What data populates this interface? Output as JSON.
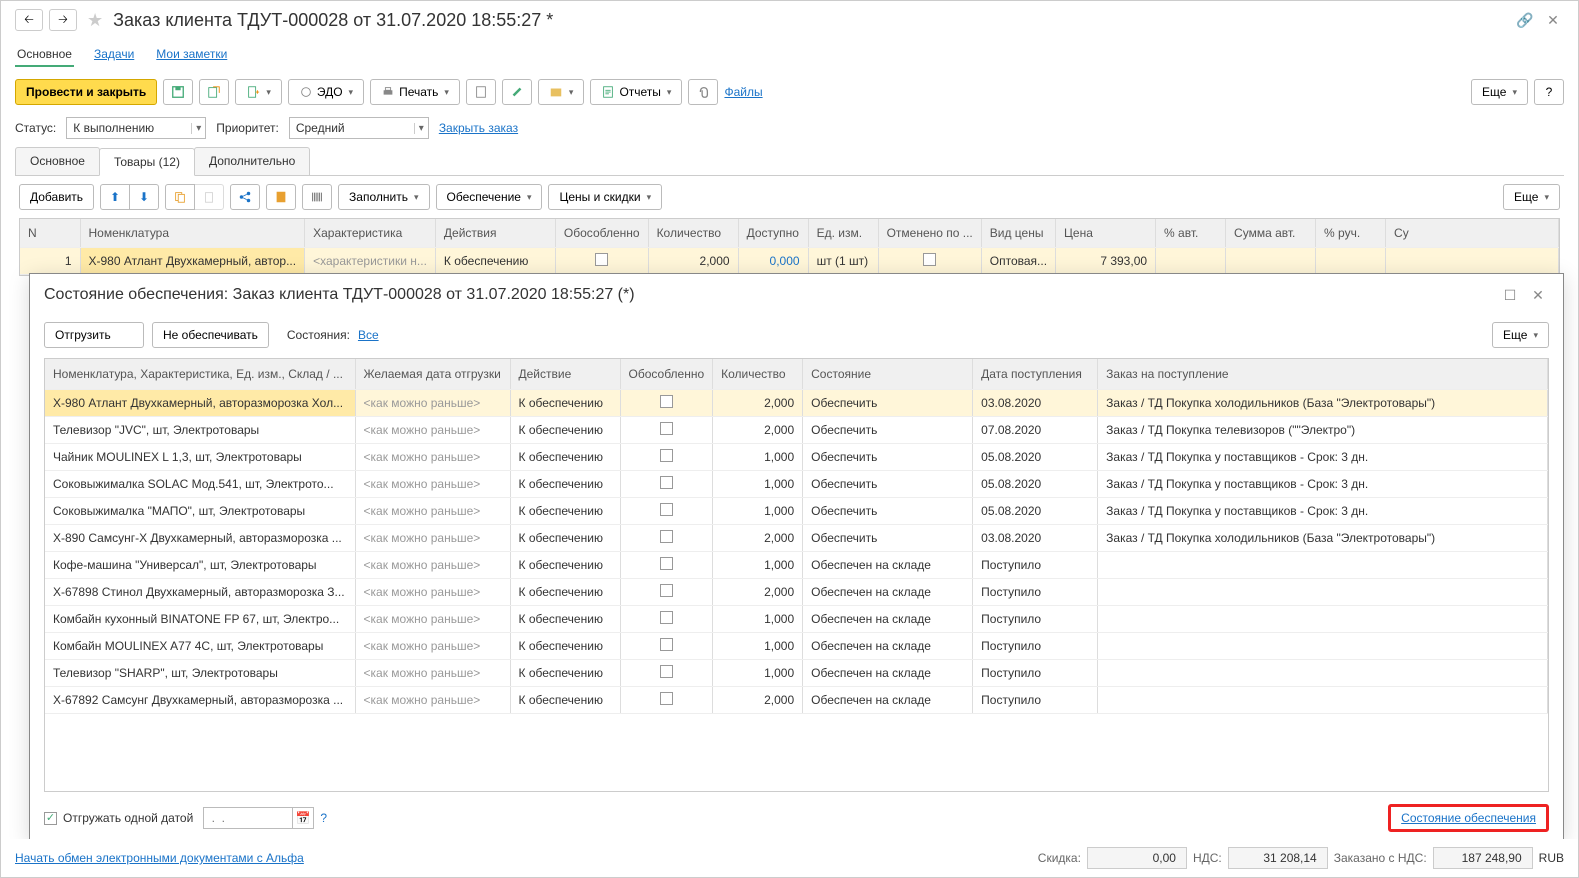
{
  "header": {
    "title": "Заказ клиента ТДУТ-000028 от 31.07.2020 18:55:27 *"
  },
  "nav": {
    "main": "Основное",
    "tasks": "Задачи",
    "notes": "Мои заметки"
  },
  "toolbar": {
    "post_close": "Провести и закрыть",
    "edo": "ЭДО",
    "print": "Печать",
    "reports": "Отчеты",
    "files": "Файлы",
    "more": "Еще",
    "help": "?"
  },
  "status": {
    "status_label": "Статус:",
    "status_value": "К выполнению",
    "priority_label": "Приоритет:",
    "priority_value": "Средний",
    "close_order": "Закрыть заказ"
  },
  "tabs": {
    "main": "Основное",
    "goods": "Товары (12)",
    "extra": "Дополнительно"
  },
  "subtoolbar": {
    "add": "Добавить",
    "fill": "Заполнить",
    "provision": "Обеспечение",
    "prices": "Цены и скидки",
    "more": "Еще"
  },
  "main_table": {
    "cols": {
      "n": "N",
      "nom": "Номенклатура",
      "char": "Характеристика",
      "actions": "Действия",
      "separate": "Обособленно",
      "qty": "Количество",
      "avail": "Доступно",
      "unit": "Ед. изм.",
      "canceled": "Отменено по ...",
      "price_type": "Вид цены",
      "price": "Цена",
      "pct_auto": "% авт.",
      "sum_auto": "Сумма авт.",
      "pct_man": "% руч.",
      "su": "Су"
    },
    "rows": [
      {
        "n": "1",
        "nom": "Х-980 Атлант Двухкамерный, автор...",
        "char": "<характеристики н...",
        "act": "К обеспечению",
        "qty": "2,000",
        "avail": "0,000",
        "unit": "шт (1 шт)",
        "price_type": "Оптовая...",
        "price": "7 393,00"
      }
    ]
  },
  "modal": {
    "title": "Состояние обеспечения: Заказ клиента ТДУТ-000028 от 31.07.2020 18:55:27 (*)",
    "ship": "Отгрузить",
    "no_provide": "Не обеспечивать",
    "states_label": "Состояния:",
    "states_value": "Все",
    "more": "Еще",
    "cols": {
      "nom": "Номенклатура, Характеристика, Ед. изм., Склад / ...",
      "date": "Желаемая дата отгрузки",
      "action": "Действие",
      "separate": "Обособленно",
      "qty": "Количество",
      "state": "Состояние",
      "rec_date": "Дата поступления",
      "order": "Заказ на поступление"
    },
    "placeholder_date": "<как можно раньше>",
    "rows": [
      {
        "nom": "Х-980 Атлант Двухкамерный, авторазморозка Хол...",
        "act": "К обеспечению",
        "qty": "2,000",
        "state": "Обеспечить",
        "rdate": "03.08.2020",
        "order": "Заказ / ТД Покупка холодильников (База \"Электротовары\")"
      },
      {
        "nom": "Телевизор \"JVC\", шт, Электротовары",
        "act": "К обеспечению",
        "qty": "2,000",
        "state": "Обеспечить",
        "rdate": "07.08.2020",
        "order": "Заказ / ТД Покупка телевизоров (\"\"Электро\")"
      },
      {
        "nom": "Чайник MOULINEX L 1,3, шт, Электротовары",
        "act": "К обеспечению",
        "qty": "1,000",
        "state": "Обеспечить",
        "rdate": "05.08.2020",
        "order": "Заказ / ТД Покупка у поставщиков - Срок: 3 дн."
      },
      {
        "nom": "Соковыжималка  SOLAC  Мод.541, шт, Электрото...",
        "act": "К обеспечению",
        "qty": "1,000",
        "state": "Обеспечить",
        "rdate": "05.08.2020",
        "order": "Заказ / ТД Покупка у поставщиков - Срок: 3 дн."
      },
      {
        "nom": "Соковыжималка \"МАПО\", шт, Электротовары",
        "act": "К обеспечению",
        "qty": "1,000",
        "state": "Обеспечить",
        "rdate": "05.08.2020",
        "order": "Заказ / ТД Покупка у поставщиков - Срок: 3 дн."
      },
      {
        "nom": "Х-890 Самсунг-Х Двухкамерный, авторазморозка ...",
        "act": "К обеспечению",
        "qty": "2,000",
        "state": "Обеспечить",
        "rdate": "03.08.2020",
        "order": "Заказ / ТД Покупка холодильников (База \"Электротовары\")"
      },
      {
        "nom": "Кофе-машина \"Универсал\", шт, Электротовары",
        "act": "К обеспечению",
        "qty": "1,000",
        "state": "Обеспечен на складе",
        "rdate": "Поступило",
        "order": ""
      },
      {
        "nom": "Х-67898 Стинол Двухкамерный, авторазморозка З...",
        "act": "К обеспечению",
        "qty": "2,000",
        "state": "Обеспечен на складе",
        "rdate": "Поступило",
        "order": ""
      },
      {
        "nom": "Комбайн кухонный BINATONE FP 67, шт, Электро...",
        "act": "К обеспечению",
        "qty": "1,000",
        "state": "Обеспечен на складе",
        "rdate": "Поступило",
        "order": ""
      },
      {
        "nom": "Комбайн MOULINEX  A77 4C, шт, Электротовары",
        "act": "К обеспечению",
        "qty": "1,000",
        "state": "Обеспечен на складе",
        "rdate": "Поступило",
        "order": ""
      },
      {
        "nom": "Телевизор \"SHARP\", шт, Электротовары",
        "act": "К обеспечению",
        "qty": "1,000",
        "state": "Обеспечен на складе",
        "rdate": "Поступило",
        "order": ""
      },
      {
        "nom": "Х-67892 Самсунг Двухкамерный, авторазморозка ...",
        "act": "К обеспечению",
        "qty": "2,000",
        "state": "Обеспечен на складе",
        "rdate": "Поступило",
        "order": ""
      }
    ],
    "footer": {
      "ship_one_date": "Отгружать одной датой",
      "date_placeholder": " .  .    ",
      "provision_link": "Состояние обеспечения"
    }
  },
  "bottom": {
    "exchange_link": "Начать обмен электронными документами с Альфа",
    "discount_label": "Скидка:",
    "discount_value": "0,00",
    "vat_label": "НДС:",
    "vat_value": "31 208,14",
    "ordered_label": "Заказано с НДС:",
    "ordered_value": "187 248,90",
    "currency": "RUB"
  }
}
